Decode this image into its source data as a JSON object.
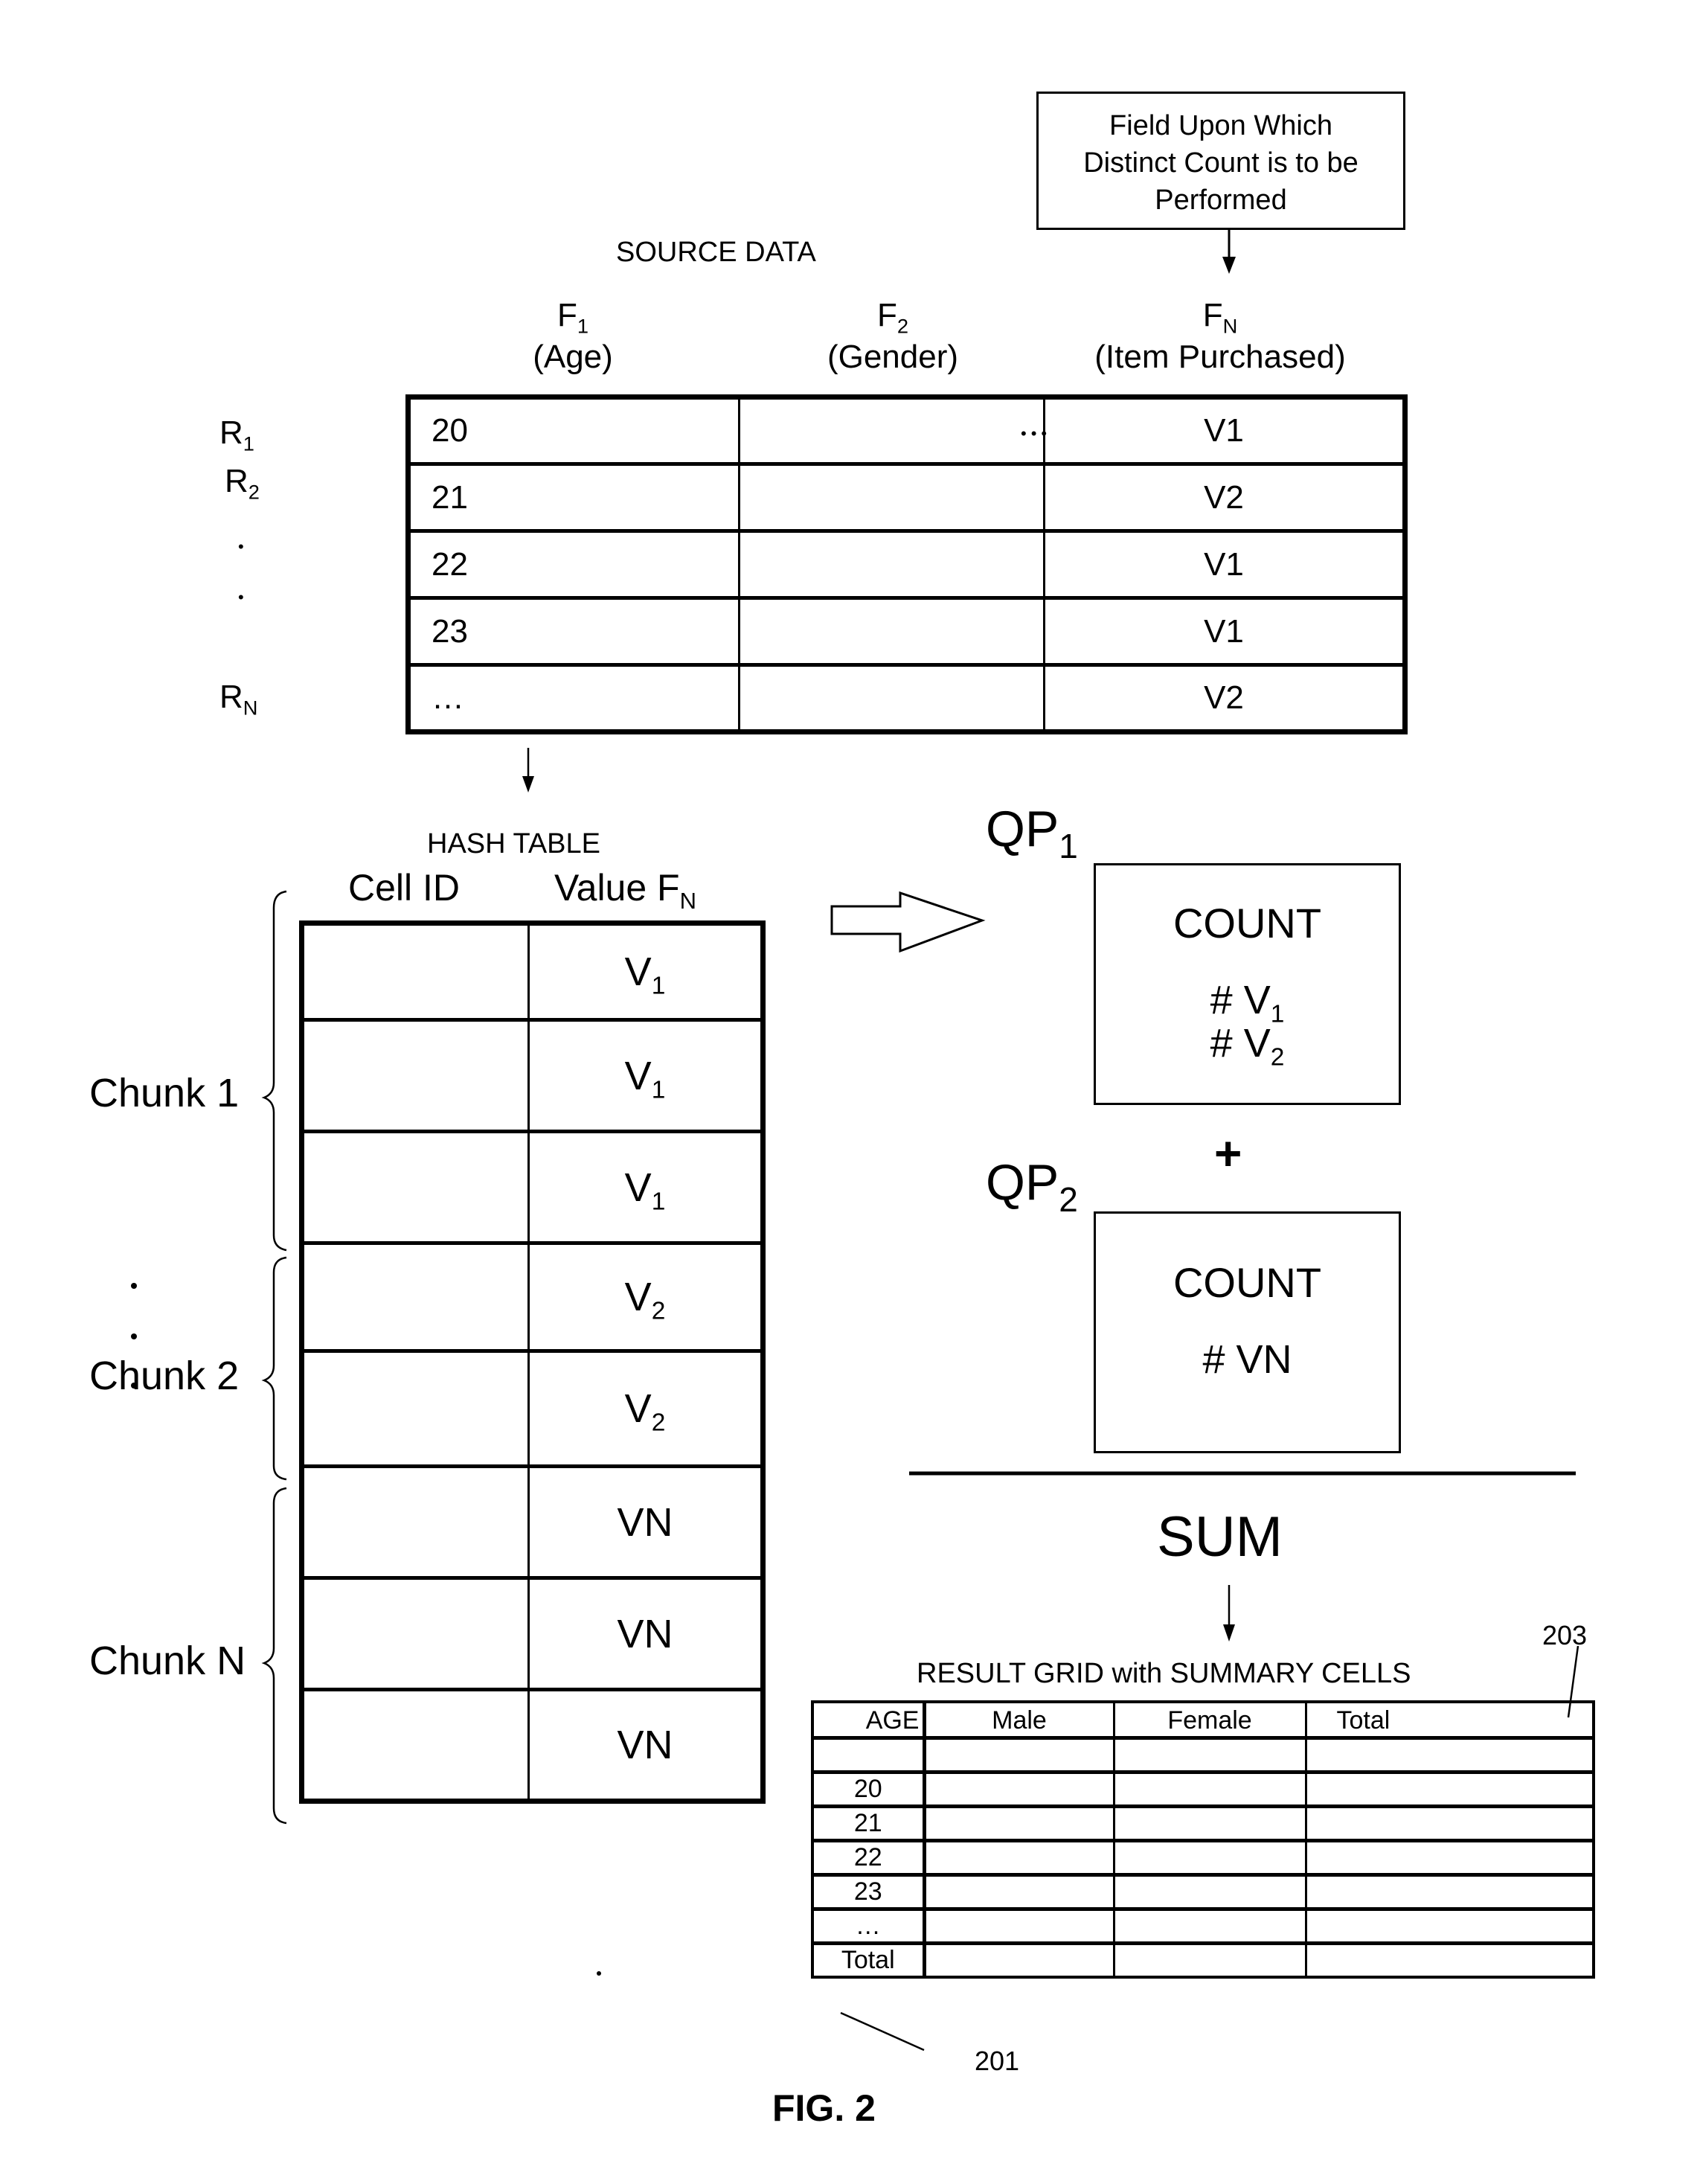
{
  "figure_label": "FIG. 2",
  "callout_box": {
    "text_lines": [
      "Field Upon Which",
      "Distinct Count is to be",
      "Performed"
    ]
  },
  "source_data": {
    "title": "SOURCE DATA",
    "columns": [
      {
        "field": "F",
        "sub": "1",
        "desc": "(Age)"
      },
      {
        "field": "F",
        "sub": "2",
        "desc": "(Gender)"
      },
      {
        "field": "F",
        "sub": "N",
        "desc": "(Item Purchased)"
      }
    ],
    "row_labels": [
      {
        "base": "R",
        "sub": "1"
      },
      {
        "base": "R",
        "sub": "2"
      },
      {
        "base": "•",
        "sub": ""
      },
      {
        "base": "•",
        "sub": ""
      },
      {
        "base": "R",
        "sub": "N"
      }
    ],
    "ellipsis": "•••",
    "rows": [
      {
        "age": "20",
        "gender": "",
        "item": "V1"
      },
      {
        "age": "21",
        "gender": "",
        "item": "V2"
      },
      {
        "age": "22",
        "gender": "",
        "item": "V1"
      },
      {
        "age": "23",
        "gender": "",
        "item": "V1"
      },
      {
        "age": "…",
        "gender": "",
        "item": "V2"
      }
    ]
  },
  "hash_table": {
    "title": "HASH TABLE",
    "col_cell_id": "Cell ID",
    "col_value": "Value F",
    "col_value_sub": "N",
    "chunks": [
      {
        "label": "Chunk 1",
        "rows": [
          {
            "v": "V",
            "s": "1"
          },
          {
            "v": "V",
            "s": "1"
          },
          {
            "v": "V",
            "s": "1"
          }
        ]
      },
      {
        "label": "Chunk 2",
        "rows": [
          {
            "v": "V",
            "s": "2"
          },
          {
            "v": "V",
            "s": "2"
          }
        ]
      },
      {
        "label": "Chunk N",
        "rows": [
          {
            "v": "VN",
            "s": ""
          },
          {
            "v": "VN",
            "s": ""
          },
          {
            "v": "VN",
            "s": ""
          }
        ]
      }
    ]
  },
  "query_processes": [
    {
      "label": "QP",
      "sub": "1",
      "title": "COUNT",
      "lines": [
        {
          "t": "# V",
          "s": "1"
        },
        {
          "t": "# V",
          "s": "2"
        }
      ]
    },
    {
      "label": "QP",
      "sub": "2",
      "title": "COUNT",
      "lines": [
        {
          "t": "# VN",
          "s": ""
        }
      ]
    }
  ],
  "plus_sign": "+",
  "sum_label": "SUM",
  "result_grid": {
    "title": "RESULT GRID with SUMMARY CELLS",
    "headers": [
      "AGE",
      "Male",
      "Female",
      "Total"
    ],
    "row_labels": [
      "",
      "20",
      "21",
      "22",
      "23",
      "…",
      "Total"
    ],
    "ref_top": "203",
    "ref_bottom": "201"
  }
}
